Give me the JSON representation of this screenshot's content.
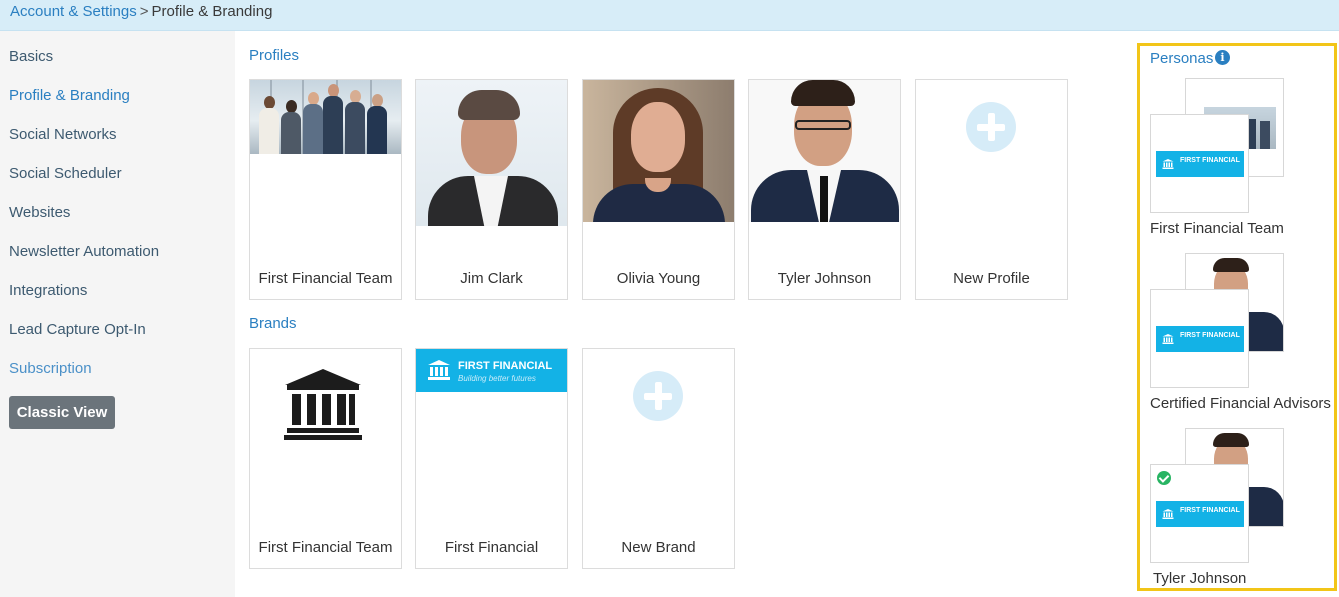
{
  "breadcrumb": {
    "parent": "Account & Settings",
    "separator": ">",
    "current": "Profile & Branding"
  },
  "sidebar": {
    "items": [
      {
        "label": "Basics"
      },
      {
        "label": "Profile & Branding"
      },
      {
        "label": "Social Networks"
      },
      {
        "label": "Social Scheduler"
      },
      {
        "label": "Websites"
      },
      {
        "label": "Newsletter Automation"
      },
      {
        "label": "Integrations"
      },
      {
        "label": "Lead Capture Opt-In"
      },
      {
        "label": "Subscription"
      }
    ],
    "classic_view_label": "Classic View"
  },
  "profiles": {
    "title": "Profiles",
    "cards": [
      {
        "label": "First Financial Team"
      },
      {
        "label": "Jim Clark"
      },
      {
        "label": "Olivia Young"
      },
      {
        "label": "Tyler Johnson"
      },
      {
        "label": "New Profile"
      }
    ]
  },
  "brands": {
    "title": "Brands",
    "cards": [
      {
        "label": "First Financial Team"
      },
      {
        "label": "First Financial"
      },
      {
        "label": "New Brand"
      }
    ],
    "banner_title": "FIRST FINANCIAL",
    "banner_tagline": "Building better futures"
  },
  "personas": {
    "title": "Personas",
    "info_glyph": "i",
    "items": [
      {
        "name": "First Financial Team",
        "banner": "FIRST FINANCIAL",
        "selected": false
      },
      {
        "name": "Certified Financial Advisors",
        "banner": "FIRST FINANCIAL",
        "selected": false
      },
      {
        "name": "Tyler Johnson",
        "banner": "FIRST FINANCIAL",
        "selected": true
      }
    ]
  },
  "colors": {
    "accent": "#2a7fc1",
    "brand_blue": "#13b2e6",
    "highlight": "#f2c518",
    "success": "#28b463"
  }
}
